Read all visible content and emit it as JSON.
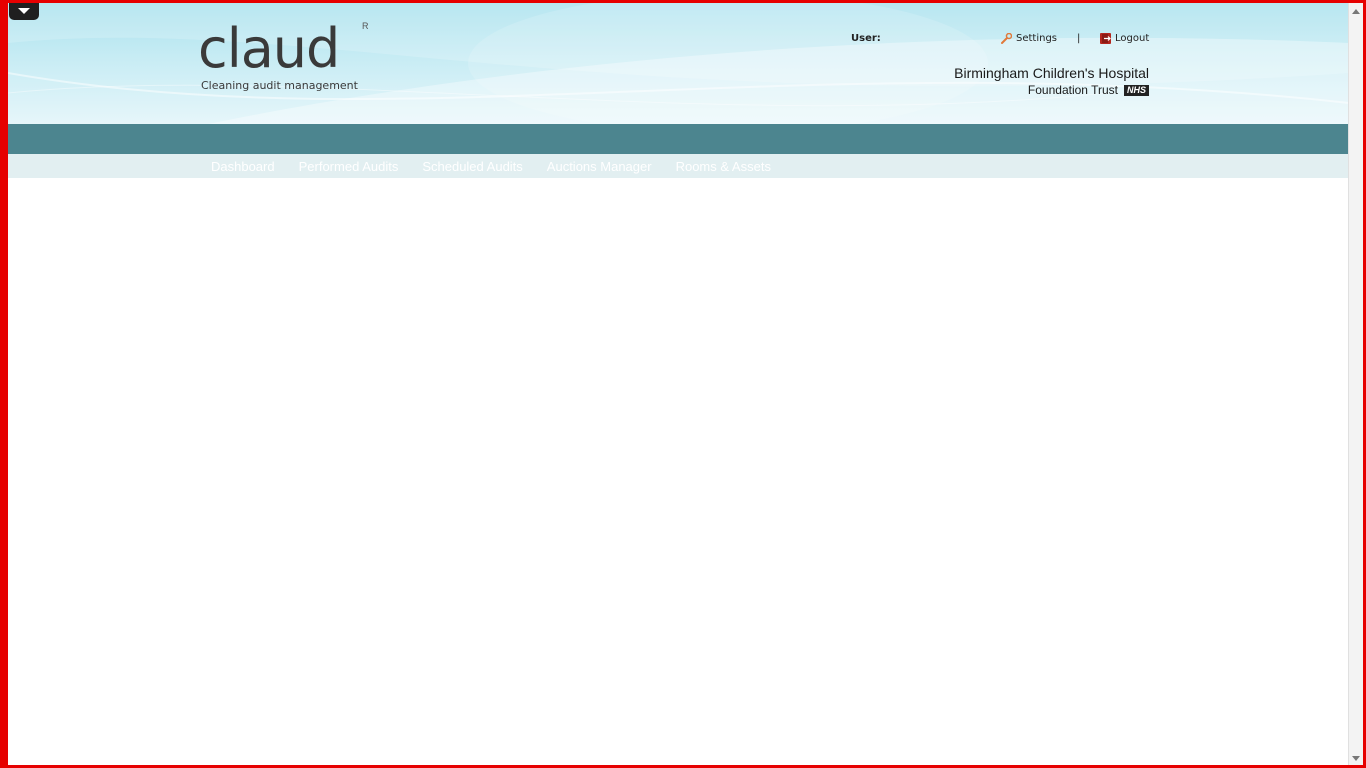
{
  "logo": {
    "wordmark": "claud",
    "registered": "R",
    "tagline": "Cleaning audit management"
  },
  "header": {
    "user_label": "User:",
    "settings_label": "Settings",
    "separator": "|",
    "logout_label": "Logout",
    "org_name": "Birmingham Children's Hospital",
    "org_sub": "Foundation Trust",
    "nhs_badge": "NHS"
  },
  "nav": {
    "items": [
      {
        "label": "Dashboard"
      },
      {
        "label": "Performed Audits"
      },
      {
        "label": "Scheduled Audits"
      },
      {
        "label": "Auctions Manager"
      },
      {
        "label": "Rooms & Assets"
      }
    ]
  },
  "icons": {
    "dropdown": "chevron-down-icon",
    "settings": "wrench-icon",
    "logout": "logout-door-icon"
  },
  "colors": {
    "frame_border": "#e60000",
    "navbar": "#4c858f",
    "subnav": "#e2eff1",
    "header_gradient_top": "#a9e1ee"
  }
}
